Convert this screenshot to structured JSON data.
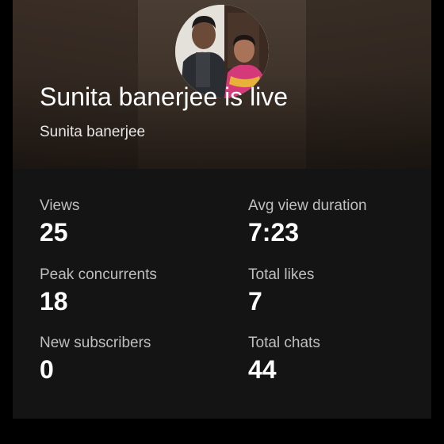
{
  "stream": {
    "title": "Sunita banerjee is live",
    "channel": "Sunita banerjee"
  },
  "stats": {
    "views": {
      "label": "Views",
      "value": "25"
    },
    "avg_view_duration": {
      "label": "Avg view duration",
      "value": "7:23"
    },
    "peak_concurrents": {
      "label": "Peak concurrents",
      "value": "18"
    },
    "total_likes": {
      "label": "Total likes",
      "value": "7"
    },
    "new_subscribers": {
      "label": "New subscribers",
      "value": "0"
    },
    "total_chats": {
      "label": "Total chats",
      "value": "44"
    }
  },
  "colors": {
    "background": "#000000",
    "card": "#141414",
    "text_primary": "#ffffff",
    "text_secondary": "#bfbfbf"
  }
}
